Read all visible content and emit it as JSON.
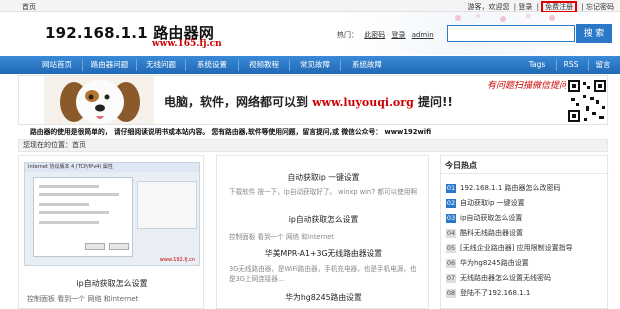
{
  "topbar": {
    "home": "首页",
    "guest": "游客，欢迎您",
    "sep1": "|",
    "login": "登录",
    "sep2": "|",
    "register": "免费注册",
    "sep3": "|",
    "forgot": "忘记密码"
  },
  "header": {
    "title": "192.168.1.1 路由器网",
    "url": "www.165.fj.cn",
    "hot_label": "热门：",
    "hot_links": [
      "此密码",
      "登录",
      "admin"
    ],
    "search_placeholder": "",
    "search_button": "搜 索"
  },
  "nav": {
    "items": [
      "网站首页",
      "路由器问题",
      "无线问题",
      "系统设置",
      "视频教程",
      "常见故障",
      "系统故障"
    ],
    "right_items": [
      "Tags",
      "RSS",
      "留言"
    ]
  },
  "banner": {
    "text_main": "电脑，软件，网络都可以到",
    "text_url": "www.luyouqi.org",
    "text_end": "提问!!",
    "qr_caption": "有问题扫描微信提问！"
  },
  "notice": "路由器的使用是很简单的，  请仔细阅读说明书或本站内容。  您有路由器,软件等使用问题，留言提问,或 微信公众号： www192wifi",
  "breadcrumb": "您现在的位置：首页",
  "card1": {
    "title": "ip自动获取怎么设置",
    "desc": "控制面板 看到一个 网络 和internet",
    "screenshot_window_title": "Internet 协议版本 4 (TCP/IPv4) 属性",
    "screenshot_watermark": "www.192.fj.cn"
  },
  "middle": {
    "articles": [
      {
        "title": "自动获取ip 一键设置",
        "desc": "下载软件 按一下，ip自动获取好了。 winxp win7 都可以使用啊"
      },
      {
        "title": "ip自动获取怎么设置",
        "desc": "控制面板 看到一个 网络 和internet"
      },
      {
        "title": "华美MPR-A1+3G无线路由器设置",
        "desc": "3G无线路由器，是WiFi路由器，手机充电器，也是手机电源，也是3G上网连接器..."
      },
      {
        "title": "华为hg8245路由设置",
        "desc": ""
      }
    ]
  },
  "hot": {
    "title": "今日热点",
    "items": [
      {
        "num": "01",
        "text": "192.168.1.1 路由器怎么改密码"
      },
      {
        "num": "02",
        "text": "自动获取ip 一键设置"
      },
      {
        "num": "03",
        "text": "ip自动获取怎么设置"
      },
      {
        "num": "04",
        "text": "酷科无线路由器设置"
      },
      {
        "num": "05",
        "text": "[无线企业路由器] 应用限制设置指导"
      },
      {
        "num": "06",
        "text": "华为hg8245路由设置"
      },
      {
        "num": "07",
        "text": "无线路由器怎么设置无线密码"
      },
      {
        "num": "08",
        "text": "登陆不了192.168.1.1"
      }
    ]
  },
  "colors": {
    "nav_blue": "#2a78c8",
    "accent_red": "#cc0000",
    "highlight_red": "#e00000"
  },
  "icons": [
    "dog-mascot-icon",
    "qr-code-icon"
  ]
}
